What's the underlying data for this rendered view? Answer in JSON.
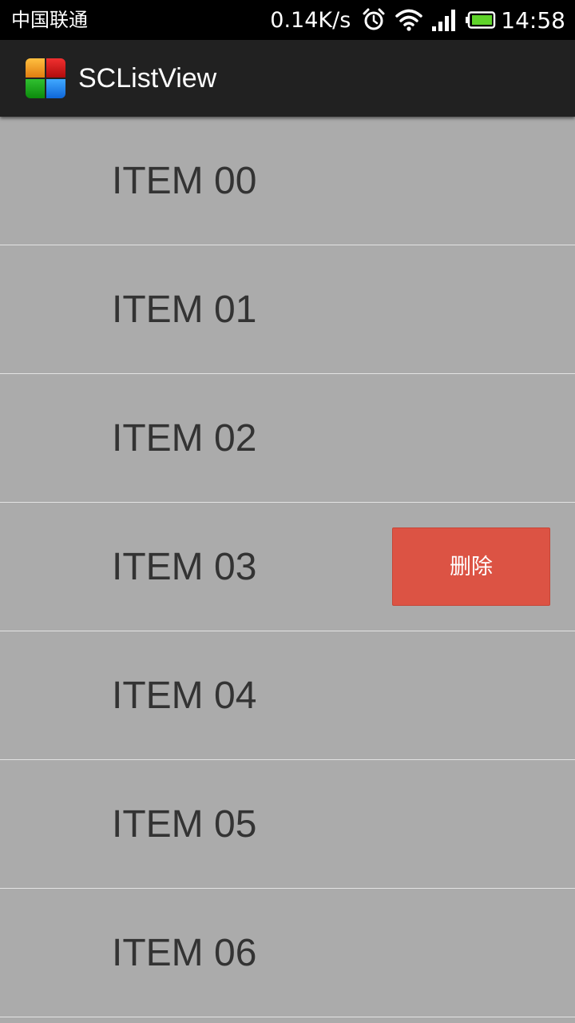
{
  "status_bar": {
    "carrier": "中国联通",
    "net_speed": "0.14K/s",
    "icons": [
      "alarm-icon",
      "wifi-icon",
      "signal-icon",
      "battery-icon"
    ],
    "time": "14:58"
  },
  "action_bar": {
    "title": "SCListView",
    "icon": "app-icon",
    "icon_colors": [
      "#f0a020",
      "#d01818",
      "#1aa01a",
      "#1a7ef0"
    ]
  },
  "list": {
    "items": [
      {
        "label": "ITEM 00"
      },
      {
        "label": "ITEM 01"
      },
      {
        "label": "ITEM 02"
      },
      {
        "label": "ITEM 03",
        "delete_label": "删除"
      },
      {
        "label": "ITEM 04"
      },
      {
        "label": "ITEM 05"
      },
      {
        "label": "ITEM 06"
      }
    ]
  },
  "colors": {
    "list_background": "#ababab",
    "divider": "#e3e3e3",
    "item_text": "#333333",
    "delete_button": "#dc5344",
    "action_bar": "#212121",
    "status_bar": "#000000"
  }
}
